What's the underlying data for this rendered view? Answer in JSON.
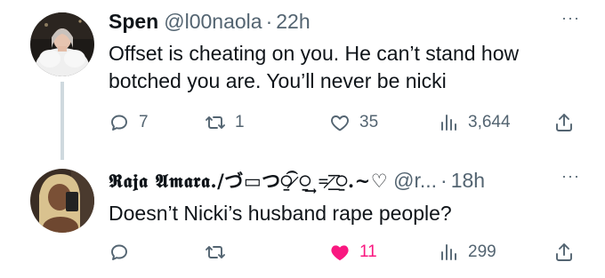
{
  "tweets": [
    {
      "display_name": "Spen",
      "handle": "@l00naola",
      "separator": "·",
      "time": "22h",
      "text": "Offset is cheating on you. He can’t stand how botched you are. You’ll never be nicki",
      "counts": {
        "replies": "7",
        "retweets": "1",
        "likes": "35",
        "views": "3,644"
      },
      "liked": false
    },
    {
      "display_name": "𝕽𝖆𝖏𝖆 𝕬𝖒𝖆𝖗𝖆./づ▭つ⍜͡ ̷⍜͢ =͟͟͞͞ ̷⍜.~♡",
      "handle": "@r...",
      "separator": "·",
      "time": "18h",
      "text": "Doesn’t Nicki’s husband rape people?",
      "counts": {
        "replies": "",
        "retweets": "",
        "likes": "11",
        "views": "299"
      },
      "liked": true
    }
  ],
  "more_glyph": "···",
  "colors": {
    "text": "#0f1419",
    "secondary": "#536471",
    "like_active": "#f91880",
    "thread_line": "#cfd9de"
  },
  "icons": [
    "reply-icon",
    "retweet-icon",
    "like-icon",
    "views-icon",
    "share-icon",
    "more-icon"
  ]
}
